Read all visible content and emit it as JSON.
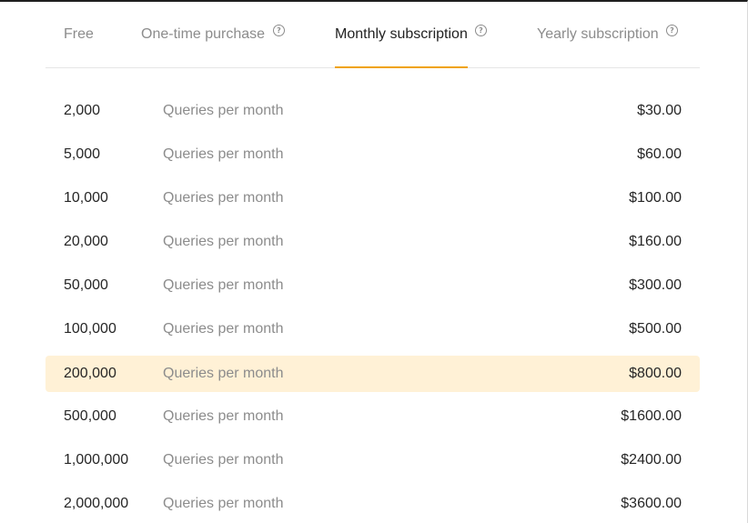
{
  "tabs": [
    {
      "label": "Free",
      "help": false,
      "active": false
    },
    {
      "label": "One-time purchase",
      "help": true,
      "active": false
    },
    {
      "label": "Monthly subscription",
      "help": true,
      "active": true
    },
    {
      "label": "Yearly subscription",
      "help": true,
      "active": false
    }
  ],
  "help_glyph": "?",
  "accent_color": "#f0a30a",
  "selected_row_color": "#fff1d6",
  "plans": [
    {
      "queries": "2,000",
      "description": "Queries per month",
      "price": "$30.00",
      "selected": false
    },
    {
      "queries": "5,000",
      "description": "Queries per month",
      "price": "$60.00",
      "selected": false
    },
    {
      "queries": "10,000",
      "description": "Queries per month",
      "price": "$100.00",
      "selected": false
    },
    {
      "queries": "20,000",
      "description": "Queries per month",
      "price": "$160.00",
      "selected": false
    },
    {
      "queries": "50,000",
      "description": "Queries per month",
      "price": "$300.00",
      "selected": false
    },
    {
      "queries": "100,000",
      "description": "Queries per month",
      "price": "$500.00",
      "selected": false
    },
    {
      "queries": "200,000",
      "description": "Queries per month",
      "price": "$800.00",
      "selected": true
    },
    {
      "queries": "500,000",
      "description": "Queries per month",
      "price": "$1600.00",
      "selected": false
    },
    {
      "queries": "1,000,000",
      "description": "Queries per month",
      "price": "$2400.00",
      "selected": false
    },
    {
      "queries": "2,000,000",
      "description": "Queries per month",
      "price": "$3600.00",
      "selected": false
    }
  ]
}
